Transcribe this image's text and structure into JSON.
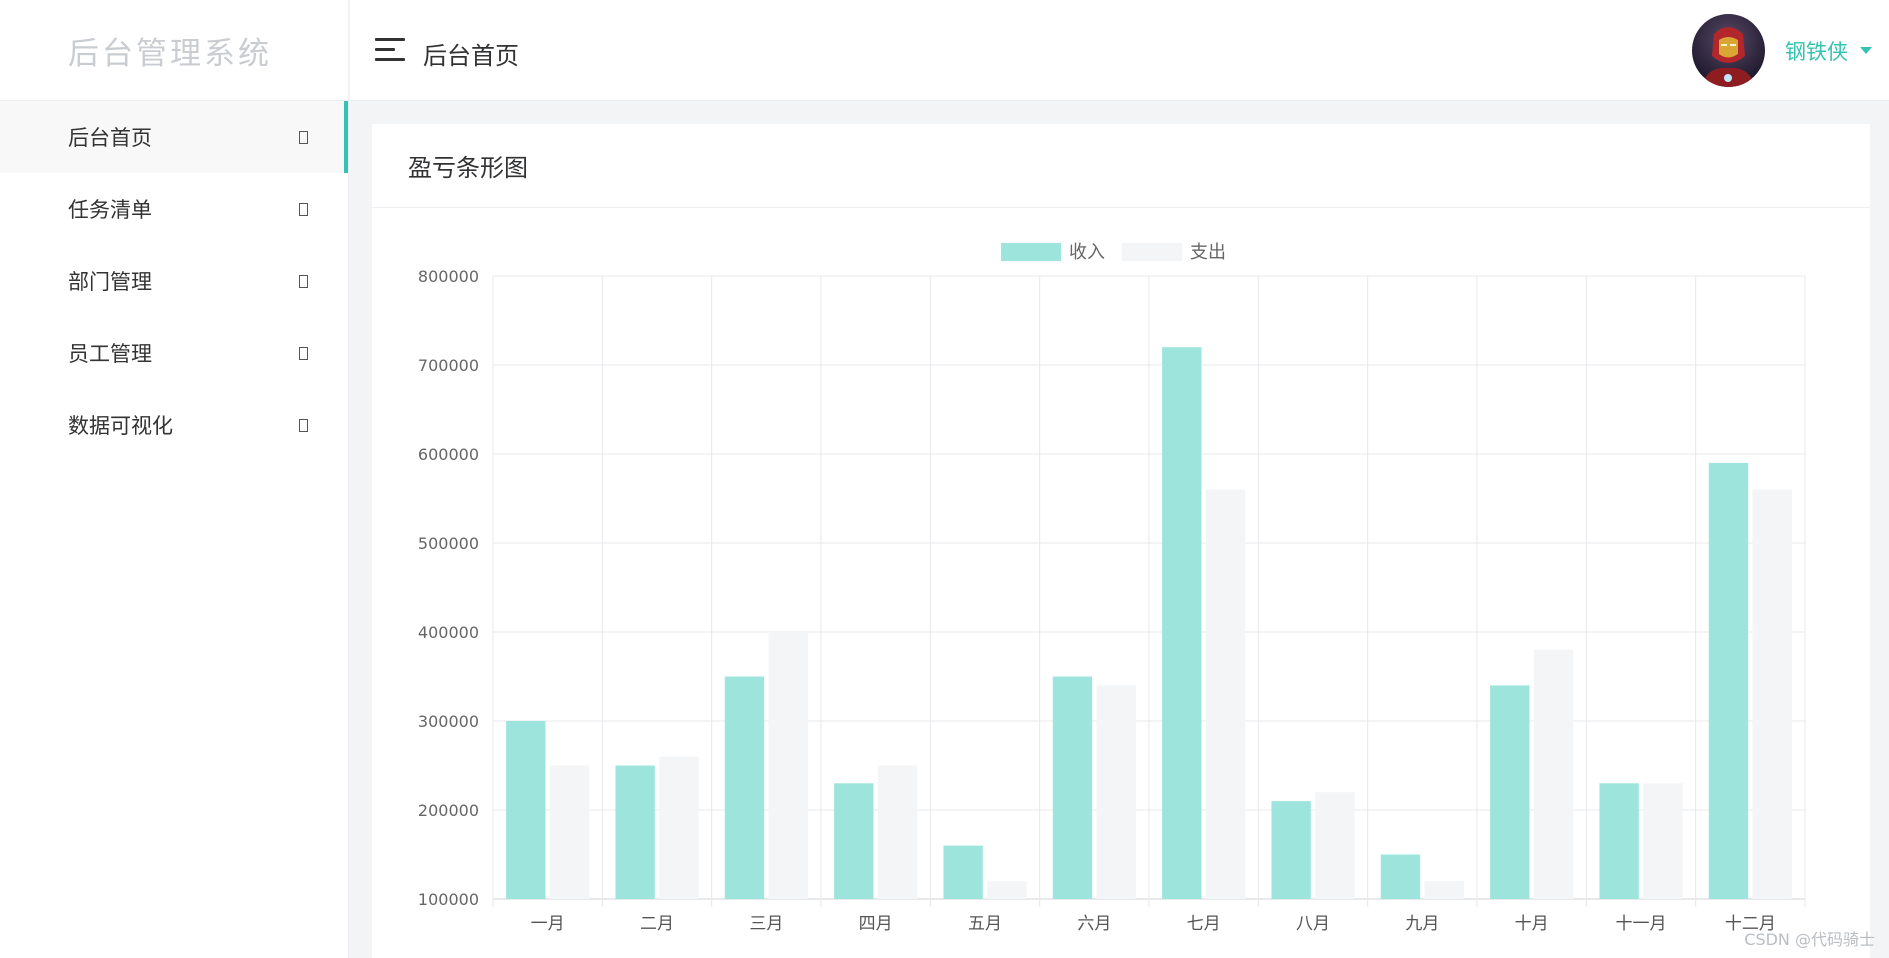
{
  "app": {
    "logo_text": "后台管理系统"
  },
  "sidebar": {
    "items": [
      {
        "label": "后台首页",
        "icon": "square-icon",
        "active": true
      },
      {
        "label": "任务清单",
        "icon": "square-icon",
        "active": false
      },
      {
        "label": "部门管理",
        "icon": "square-icon",
        "active": false
      },
      {
        "label": "员工管理",
        "icon": "square-icon",
        "active": false
      },
      {
        "label": "数据可视化",
        "icon": "square-icon",
        "active": false
      }
    ]
  },
  "header": {
    "title": "后台首页",
    "username": "钢铁侠",
    "avatar_icon": "avatar-ironman"
  },
  "card": {
    "title": "盈亏条形图"
  },
  "colors": {
    "accent": "#33c3b0",
    "income_bar": "#9de5dc",
    "expense_bar": "#f4f5f7"
  },
  "chart_data": {
    "type": "bar",
    "title": "",
    "xlabel": "",
    "ylabel": "",
    "categories": [
      "一月",
      "二月",
      "三月",
      "四月",
      "五月",
      "六月",
      "七月",
      "八月",
      "九月",
      "十月",
      "十一月",
      "十二月"
    ],
    "series": [
      {
        "name": "收入",
        "values": [
          300000,
          250000,
          350000,
          230000,
          160000,
          350000,
          720000,
          210000,
          150000,
          340000,
          230000,
          590000
        ]
      },
      {
        "name": "支出",
        "values": [
          250000,
          260000,
          400000,
          250000,
          120000,
          340000,
          560000,
          220000,
          120000,
          380000,
          230000,
          560000
        ]
      }
    ],
    "ylim": [
      100000,
      800000
    ],
    "yticks": [
      100000,
      200000,
      300000,
      400000,
      500000,
      600000,
      700000,
      800000
    ],
    "grid": true,
    "legend": "top-center"
  },
  "watermark": "CSDN @代码骑士"
}
